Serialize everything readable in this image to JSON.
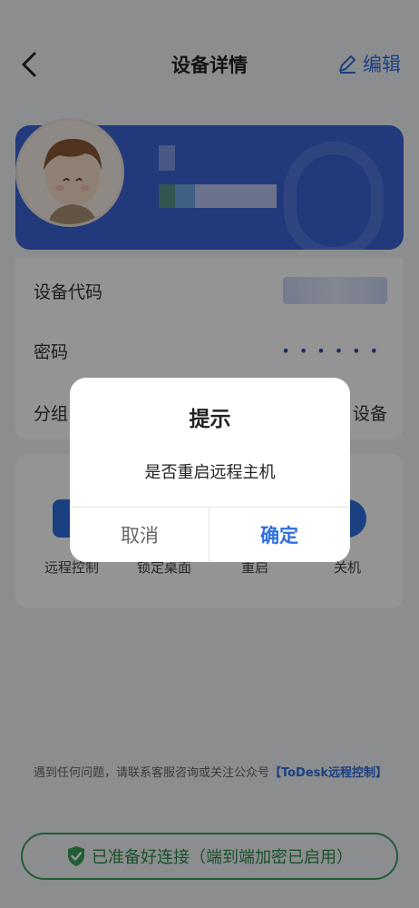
{
  "header": {
    "title": "设备详情",
    "edit_label": "编辑"
  },
  "info": {
    "device_code_label": "设备代码",
    "password_label": "密码",
    "password_value": "••••••",
    "group_label": "分组",
    "group_value": "设备"
  },
  "actions": [
    {
      "label": "远程控制",
      "icon": "monitor-icon"
    },
    {
      "label": "锁定桌面",
      "icon": "lock-icon"
    },
    {
      "label": "重启",
      "icon": "restart-icon"
    },
    {
      "label": "关机",
      "icon": "power-icon"
    }
  ],
  "help": {
    "text": "遇到任何问题，请联系客服咨询或关注公众号",
    "link": "【ToDesk远程控制】"
  },
  "status": {
    "text": "已准备好连接（端到端加密已启用）",
    "icon": "shield-check-icon"
  },
  "dialog": {
    "title": "提示",
    "message": "是否重启远程主机",
    "cancel_label": "取消",
    "confirm_label": "确定"
  },
  "colors": {
    "accent": "#2f6fe0",
    "card": "#3b63d6",
    "success": "#3aa05a",
    "overlay": "rgba(0,0,0,0.42)"
  }
}
